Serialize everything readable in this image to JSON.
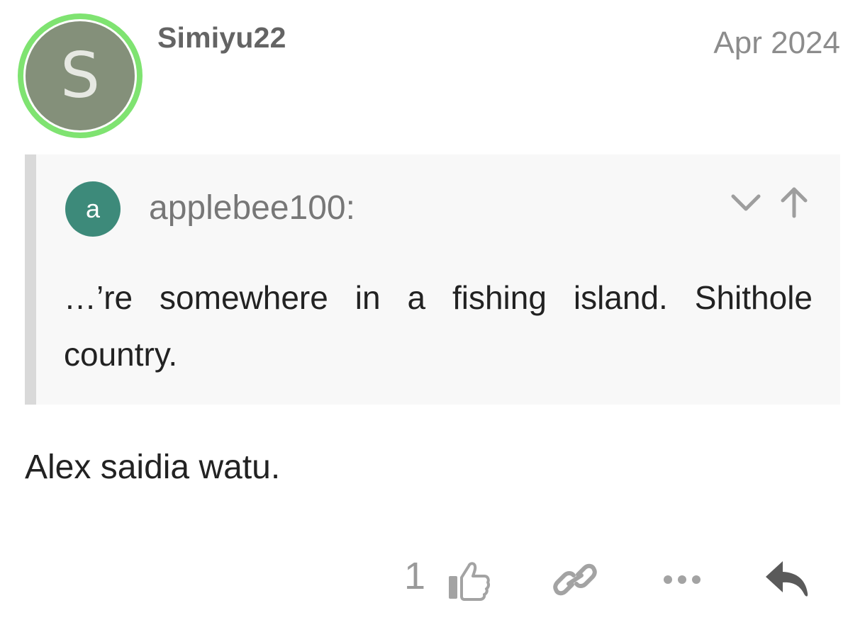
{
  "post": {
    "avatar_letter": "S",
    "avatar_color": "#84907a",
    "avatar_ring_color": "#7fe371",
    "username": "Simiyu22",
    "date": "Apr 2024",
    "body": "Alex saidia watu."
  },
  "quote": {
    "avatar_letter": "a",
    "avatar_color": "#3d8a7a",
    "username": "applebee100:",
    "text": "…’re somewhere in a fishing island. Shithole country.",
    "controls": [
      {
        "icon": "chevron-down-icon"
      },
      {
        "icon": "arrow-up-icon"
      }
    ]
  },
  "actions": {
    "like_count": "1",
    "icons": [
      "thumbs-up-icon",
      "link-icon",
      "more-icon",
      "reply-icon"
    ]
  }
}
